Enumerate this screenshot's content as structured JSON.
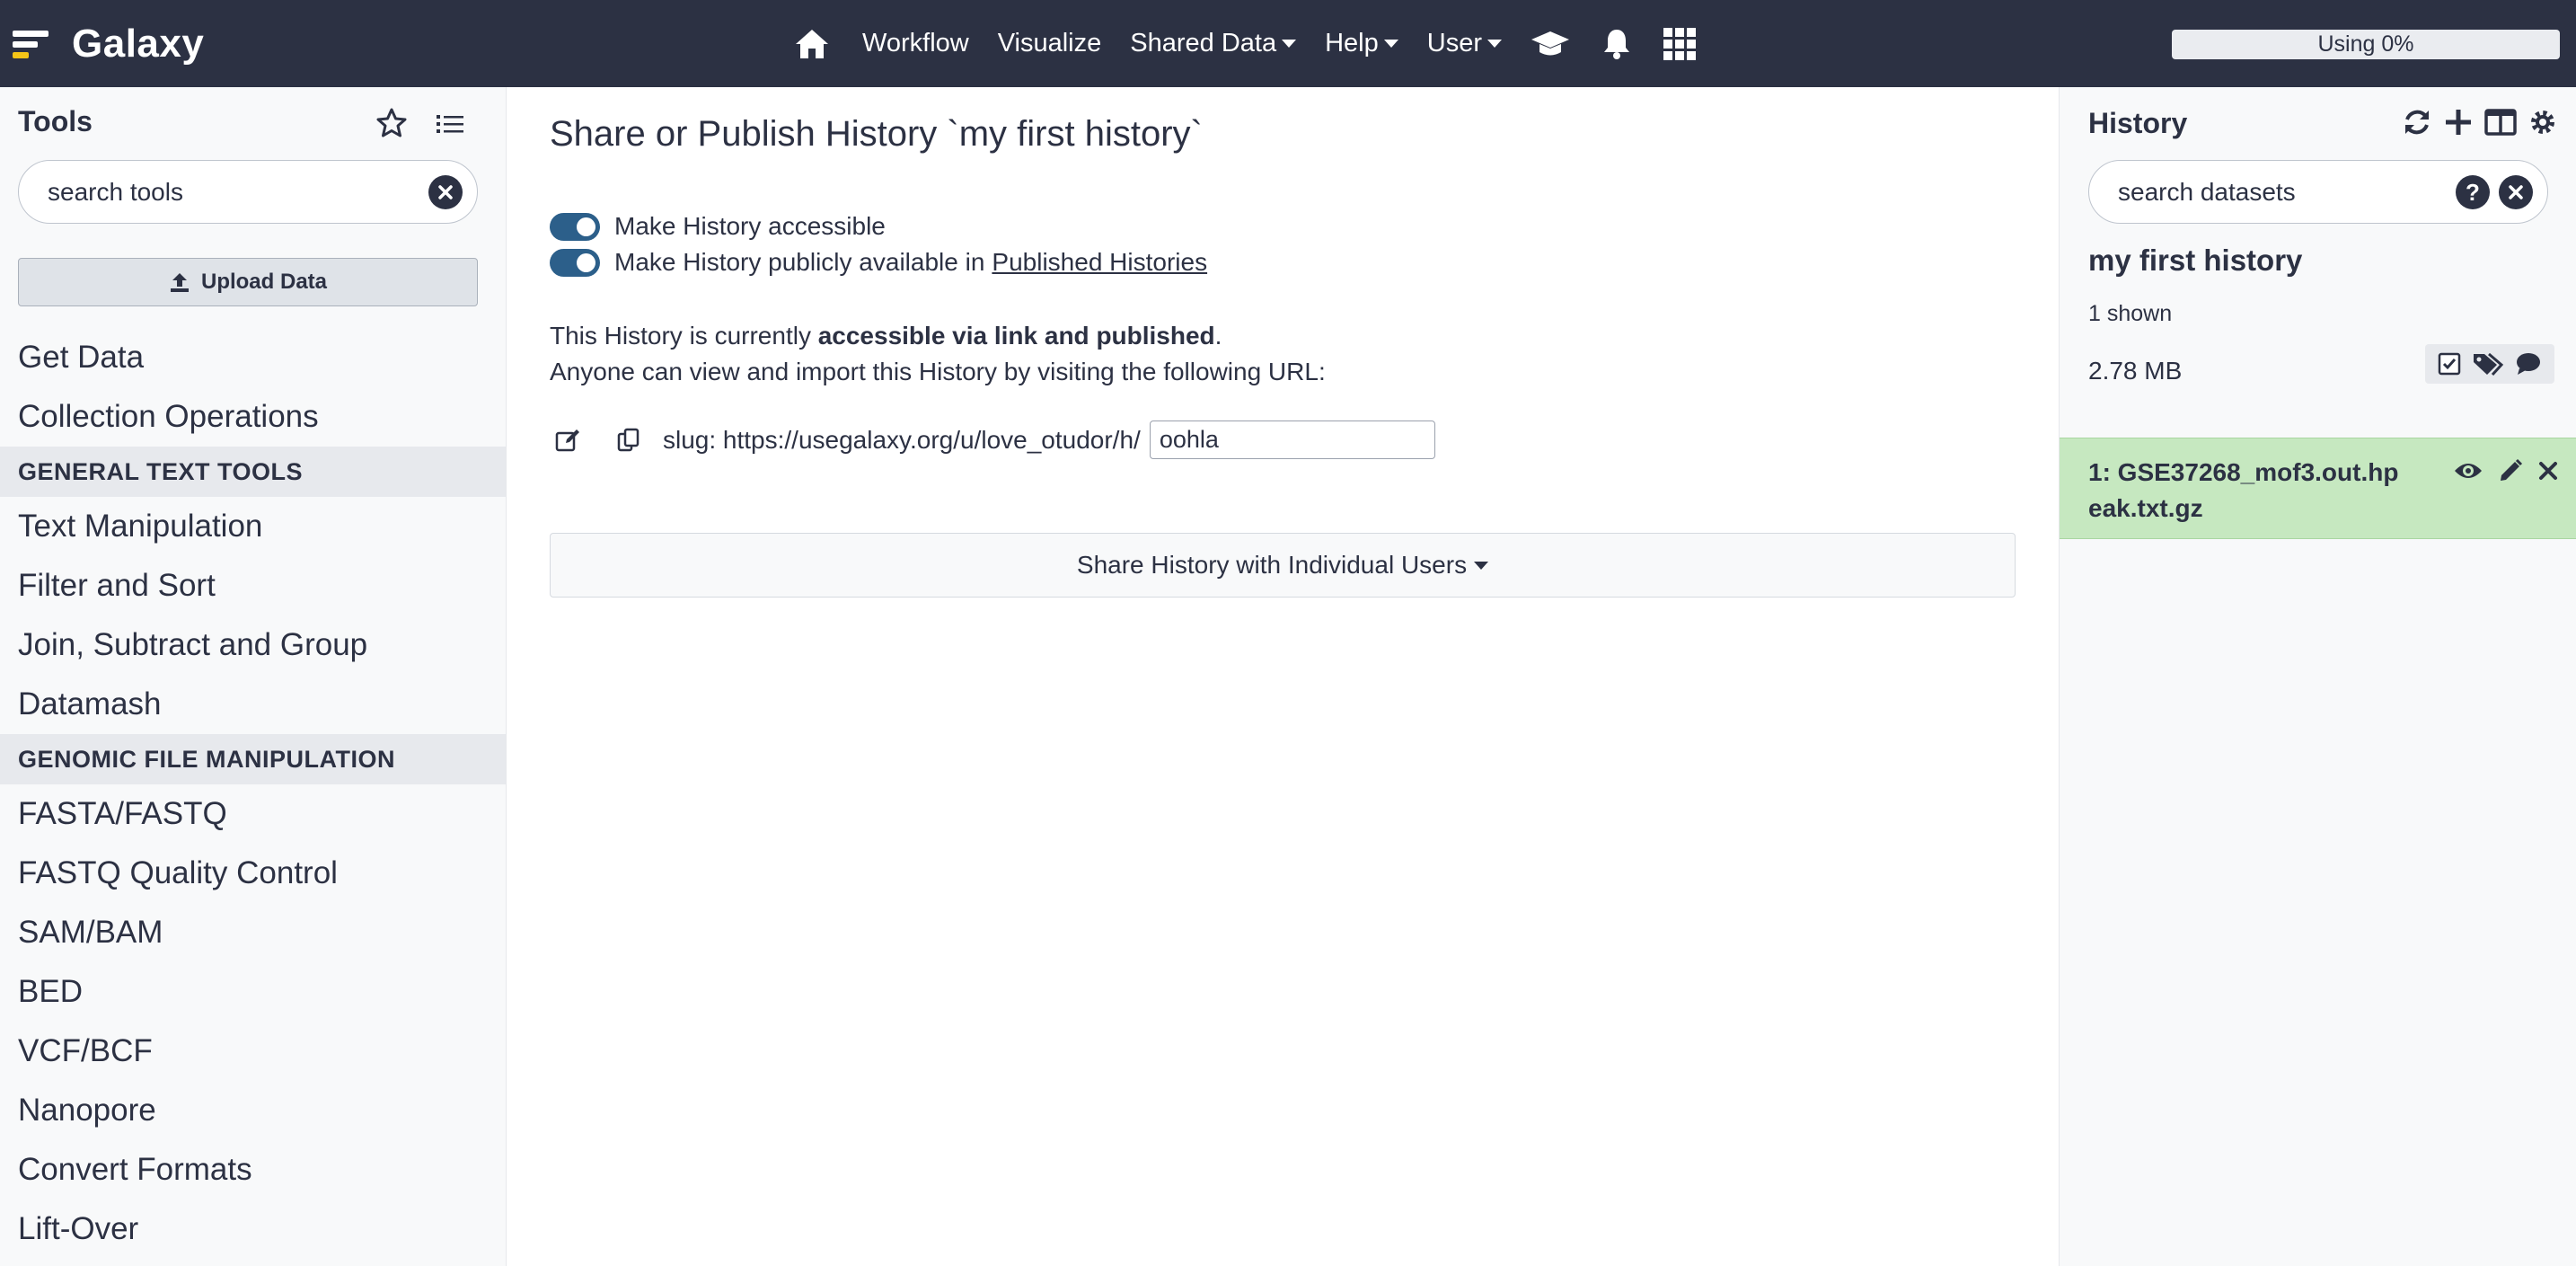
{
  "navbar": {
    "brand": "Galaxy",
    "items": [
      {
        "label": "Workflow",
        "dropdown": false
      },
      {
        "label": "Visualize",
        "dropdown": false
      },
      {
        "label": "Shared Data",
        "dropdown": true
      },
      {
        "label": "Help",
        "dropdown": true
      },
      {
        "label": "User",
        "dropdown": true
      }
    ],
    "icons": [
      "home-icon",
      "graduation-cap-icon",
      "bell-icon",
      "grid-icon"
    ],
    "quota": "Using 0%"
  },
  "tools_panel": {
    "title": "Tools",
    "search_placeholder": "search tools",
    "upload_label": "Upload Data",
    "entries": [
      {
        "type": "category",
        "label": "Get Data"
      },
      {
        "type": "category",
        "label": "Collection Operations"
      },
      {
        "type": "section",
        "label": "GENERAL TEXT TOOLS"
      },
      {
        "type": "category",
        "label": "Text Manipulation"
      },
      {
        "type": "category",
        "label": "Filter and Sort"
      },
      {
        "type": "category",
        "label": "Join, Subtract and Group"
      },
      {
        "type": "category",
        "label": "Datamash"
      },
      {
        "type": "section",
        "label": "GENOMIC FILE MANIPULATION"
      },
      {
        "type": "category",
        "label": "FASTA/FASTQ"
      },
      {
        "type": "category",
        "label": "FASTQ Quality Control"
      },
      {
        "type": "category",
        "label": "SAM/BAM"
      },
      {
        "type": "category",
        "label": "BED"
      },
      {
        "type": "category",
        "label": "VCF/BCF"
      },
      {
        "type": "category",
        "label": "Nanopore"
      },
      {
        "type": "category",
        "label": "Convert Formats"
      },
      {
        "type": "category",
        "label": "Lift-Over"
      }
    ]
  },
  "main": {
    "title": "Share or Publish History `my first history`",
    "toggle_accessible": {
      "label": "Make History accessible",
      "checked": true
    },
    "toggle_published": {
      "label_before": "Make History publicly available in",
      "link": "Published Histories",
      "checked": true
    },
    "status_prefix": "This History is currently",
    "status_bold": "accessible via link and published",
    "status_suffix": ".",
    "status_line2": "Anyone can view and import this History by visiting the following URL:",
    "slug_label": "slug: https://usegalaxy.org/u/love_otudor/h/",
    "slug_value": "oohla",
    "share_button": "Share History with Individual Users"
  },
  "history_panel": {
    "title": "History",
    "search_placeholder": "search datasets",
    "history_name": "my first history",
    "shown": "1 shown",
    "size": "2.78 MB",
    "datasets": [
      {
        "title": "1: GSE37268_mof3.out.hpeak.txt.gz",
        "state_color": "#c6e8c0"
      }
    ]
  },
  "colors": {
    "navbar": "#2c3143",
    "toggle_on": "#2c5f8a",
    "dataset_ok": "#c6e8c0",
    "section_bg": "#e7e9ed"
  }
}
